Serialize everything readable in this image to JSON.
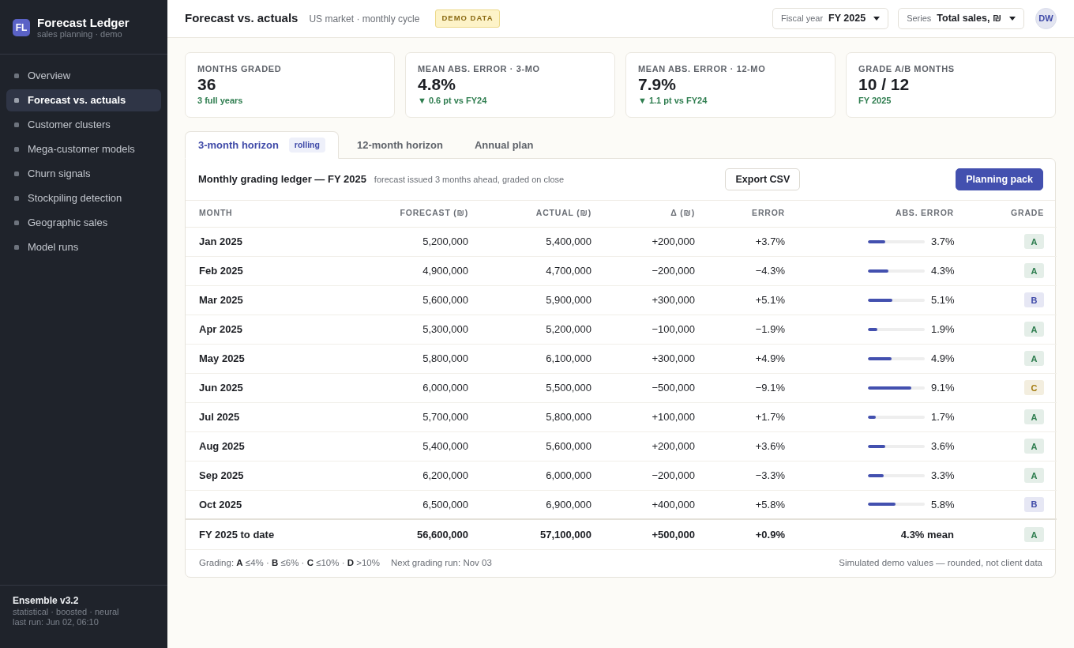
{
  "sidebar": {
    "brand": {
      "logo": "FL",
      "name": "Forecast Ledger",
      "tagline": "sales planning · demo"
    },
    "items": [
      {
        "label": "Overview",
        "selected": false
      },
      {
        "label": "Forecast vs. actuals",
        "selected": true
      },
      {
        "label": "Customer clusters",
        "selected": false
      },
      {
        "label": "Mega-customer models",
        "selected": false
      },
      {
        "label": "Churn signals",
        "selected": false
      },
      {
        "label": "Stockpiling detection",
        "selected": false
      },
      {
        "label": "Geographic sales",
        "selected": false
      },
      {
        "label": "Model runs",
        "selected": false
      }
    ],
    "footer": {
      "model": "Ensemble v3.2",
      "components": "statistical · boosted · neural",
      "last_run": "last run: Jun 02, 06:10"
    }
  },
  "header": {
    "title": "Forecast vs. actuals",
    "subtitle": "US market · monthly cycle",
    "badge": "DEMO DATA",
    "selectors": [
      {
        "label": "Fiscal year",
        "value": "FY 2025"
      },
      {
        "label": "Series",
        "value": "Total sales, ₪"
      }
    ],
    "avatar": "DW"
  },
  "kpis": [
    {
      "label": "MONTHS GRADED",
      "value": "36",
      "note": "3 full years"
    },
    {
      "label": "MEAN ABS. ERROR · 3-MO",
      "value": "4.8%",
      "note": "▼ 0.6 pt vs FY24"
    },
    {
      "label": "MEAN ABS. ERROR · 12-MO",
      "value": "7.9%",
      "note": "▼ 1.1 pt vs FY24"
    },
    {
      "label": "GRADE A/B MONTHS",
      "value": "10 / 12",
      "note": "FY 2025"
    }
  ],
  "tabs": [
    {
      "label": "3-month horizon",
      "badge": "rolling",
      "selected": true
    },
    {
      "label": "12-month horizon",
      "selected": false
    },
    {
      "label": "Annual plan",
      "selected": false
    }
  ],
  "ledger": {
    "title": "Monthly grading ledger — FY 2025",
    "subtitle": "forecast issued 3 months ahead, graded on close",
    "buttons": [
      {
        "label": "Export CSV",
        "kind": "outline"
      },
      {
        "label": "Planning pack",
        "kind": "primary"
      }
    ],
    "table": {
      "columns": [
        "MONTH",
        "FORECAST (₪)",
        "ACTUAL (₪)",
        "Δ (₪)",
        "ERROR",
        "ABS. ERROR",
        "GRADE"
      ],
      "rows": [
        {
          "month": "Jan 2025",
          "forecast": "5,200,000",
          "actual": "5,400,000",
          "delta": "+200,000",
          "error": "+3.7%",
          "abs_error": {
            "level": 0.31,
            "reading": "3.7%"
          },
          "grade": {
            "text": "A",
            "color": "#2e7d4f"
          }
        },
        {
          "month": "Feb 2025",
          "forecast": "4,900,000",
          "actual": "4,700,000",
          "delta": "−200,000",
          "error": "−4.3%",
          "abs_error": {
            "level": 0.36,
            "reading": "4.3%"
          },
          "grade": {
            "text": "A",
            "color": "#2e7d4f"
          }
        },
        {
          "month": "Mar 2025",
          "forecast": "5,600,000",
          "actual": "5,900,000",
          "delta": "+300,000",
          "error": "+5.1%",
          "abs_error": {
            "level": 0.43,
            "reading": "5.1%"
          },
          "grade": {
            "text": "B",
            "color": "#3f4aa8"
          }
        },
        {
          "month": "Apr 2025",
          "forecast": "5,300,000",
          "actual": "5,200,000",
          "delta": "−100,000",
          "error": "−1.9%",
          "abs_error": {
            "level": 0.16,
            "reading": "1.9%"
          },
          "grade": {
            "text": "A",
            "color": "#2e7d4f"
          }
        },
        {
          "month": "May 2025",
          "forecast": "5,800,000",
          "actual": "6,100,000",
          "delta": "+300,000",
          "error": "+4.9%",
          "abs_error": {
            "level": 0.41,
            "reading": "4.9%"
          },
          "grade": {
            "text": "A",
            "color": "#2e7d4f"
          }
        },
        {
          "month": "Jun 2025",
          "forecast": "6,000,000",
          "actual": "5,500,000",
          "delta": "−500,000",
          "error": "−9.1%",
          "abs_error": {
            "level": 0.76,
            "reading": "9.1%"
          },
          "grade": {
            "text": "C",
            "color": "#a37a0c"
          }
        },
        {
          "month": "Jul 2025",
          "forecast": "5,700,000",
          "actual": "5,800,000",
          "delta": "+100,000",
          "error": "+1.7%",
          "abs_error": {
            "level": 0.14,
            "reading": "1.7%"
          },
          "grade": {
            "text": "A",
            "color": "#2e7d4f"
          }
        },
        {
          "month": "Aug 2025",
          "forecast": "5,400,000",
          "actual": "5,600,000",
          "delta": "+200,000",
          "error": "+3.6%",
          "abs_error": {
            "level": 0.3,
            "reading": "3.6%"
          },
          "grade": {
            "text": "A",
            "color": "#2e7d4f"
          }
        },
        {
          "month": "Sep 2025",
          "forecast": "6,200,000",
          "actual": "6,000,000",
          "delta": "−200,000",
          "error": "−3.3%",
          "abs_error": {
            "level": 0.28,
            "reading": "3.3%"
          },
          "grade": {
            "text": "A",
            "color": "#2e7d4f"
          }
        },
        {
          "month": "Oct 2025",
          "forecast": "6,500,000",
          "actual": "6,900,000",
          "delta": "+400,000",
          "error": "+5.8%",
          "abs_error": {
            "level": 0.48,
            "reading": "5.8%"
          },
          "grade": {
            "text": "B",
            "color": "#3f4aa8"
          }
        }
      ],
      "total": {
        "month": "FY 2025 to date",
        "forecast": "56,600,000",
        "actual": "57,100,000",
        "delta": "+500,000",
        "error": "+0.9%",
        "abs_error": "4.3% mean",
        "grade": {
          "text": "A",
          "color": "#2e7d4f"
        }
      }
    },
    "legend": "Grading: **A** ≤4% · **B** ≤6% · **C** ≤10% · **D** >10%",
    "next_run": "Next grading run: Nov 03",
    "disclaimer": "Simulated demo values — rounded, not client data"
  }
}
